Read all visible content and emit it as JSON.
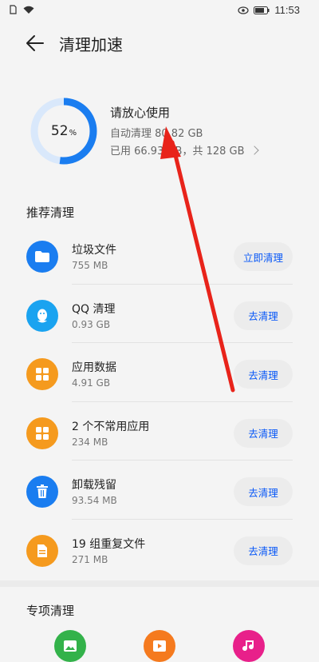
{
  "status_bar": {
    "time": "11:53"
  },
  "header": {
    "title": "清理加速"
  },
  "summary": {
    "percent": "52",
    "percent_unit": "%",
    "used_fraction": 0.52,
    "title": "请放心使用",
    "auto_clean": "自动清理 80.82 GB",
    "used": "已用 66.93 GB，共 128 GB"
  },
  "recommended": {
    "title": "推荐清理",
    "items": [
      {
        "name": "垃圾文件",
        "size": "755 MB",
        "button": "立即清理",
        "icon": "folder-icon",
        "color": "#1a7df0"
      },
      {
        "name": "QQ 清理",
        "size": "0.93 GB",
        "button": "去清理",
        "icon": "qq-icon",
        "color": "#1aa3f0"
      },
      {
        "name": "应用数据",
        "size": "4.91 GB",
        "button": "去清理",
        "icon": "app-data-icon",
        "color": "#f59a1e"
      },
      {
        "name": "2 个不常用应用",
        "size": "234 MB",
        "button": "去清理",
        "icon": "apps-grid-icon",
        "color": "#f59a1e"
      },
      {
        "name": "卸载残留",
        "size": "93.54 MB",
        "button": "去清理",
        "icon": "trash-icon",
        "color": "#1a7df0"
      },
      {
        "name": "19 组重复文件",
        "size": "271 MB",
        "button": "去清理",
        "icon": "duplicate-file-icon",
        "color": "#f59a1e"
      }
    ]
  },
  "special": {
    "title": "专项清理",
    "icons": [
      {
        "icon": "image-icon",
        "color": "#33b24a"
      },
      {
        "icon": "video-icon",
        "color": "#f57a1e"
      },
      {
        "icon": "music-icon",
        "color": "#e8208a"
      }
    ]
  }
}
